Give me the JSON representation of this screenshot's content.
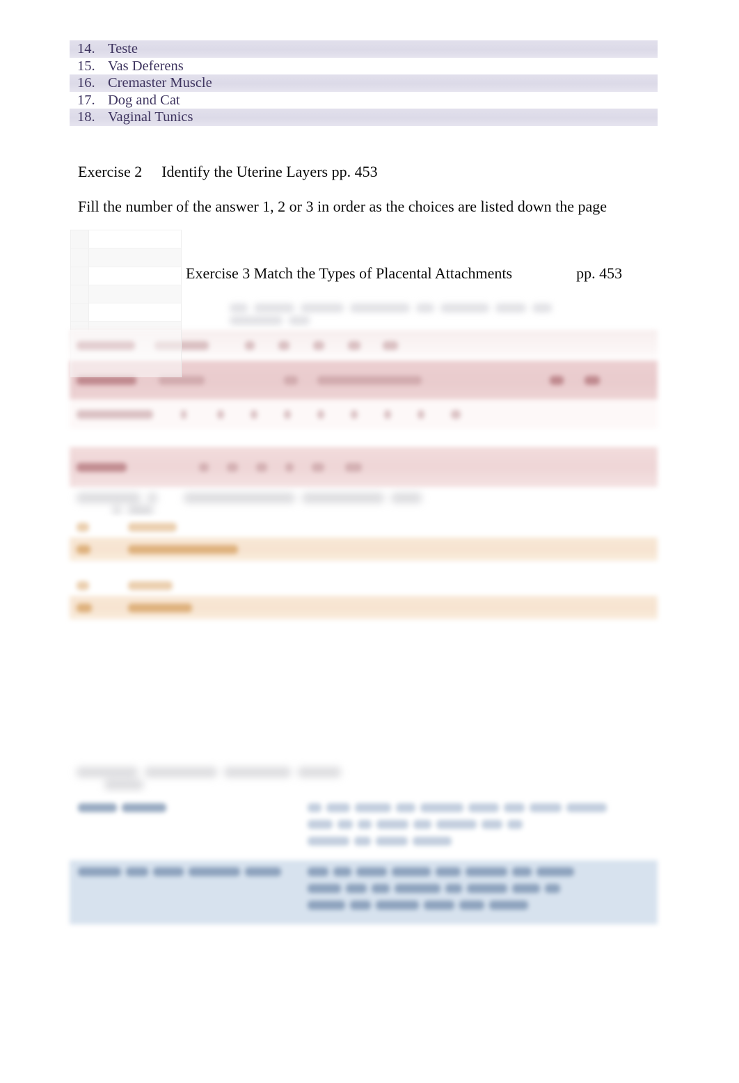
{
  "document": {
    "page_background": "#ffffff",
    "accent_lavender": "#dedce9",
    "accent_rose": "#e9cbcd",
    "accent_peach": "#f6e3d0",
    "accent_blue": "#d3dfed",
    "list_text_color": "#3f3560"
  },
  "numbered_list": {
    "items": [
      {
        "number": "14.",
        "label": "Teste",
        "shaded": true
      },
      {
        "number": "15.",
        "label": "Vas Deferens",
        "shaded": false
      },
      {
        "number": "16.",
        "label": "Cremaster Muscle",
        "shaded": true
      },
      {
        "number": "17.",
        "label": "Dog and Cat",
        "shaded": false
      },
      {
        "number": "18.",
        "label": "Vaginal Tunics",
        "shaded": true
      }
    ]
  },
  "exercise2": {
    "label": "Exercise 2",
    "title": "Identify the Uterine Layers pp. 453",
    "instruction": "Fill the number of the answer 1, 2 or 3 in order as the choices are listed down the page"
  },
  "exercise3": {
    "heading": "Exercise 3 Match the Types of Placental Attachments",
    "page_ref": "pp. 453",
    "subtitle_illegible": true
  },
  "exercise4": {
    "heading_illegible": true
  },
  "exercise5": {
    "heading_illegible": true
  }
}
